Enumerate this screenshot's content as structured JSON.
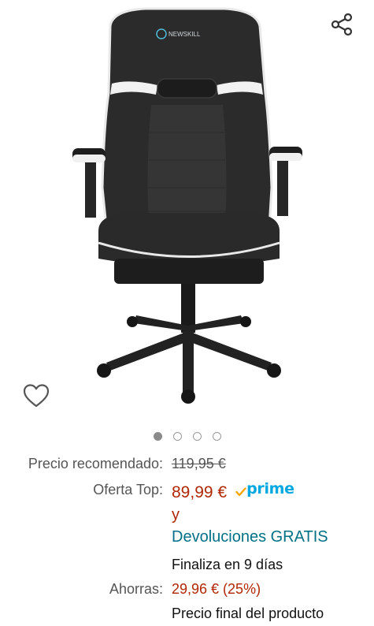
{
  "product": {
    "image_alt": "Silla gaming Newskill negra con ribetes blancos",
    "brand_on_chair": "NEWSKILL",
    "carousel": {
      "count": 4,
      "active_index": 0
    }
  },
  "pricing": {
    "recommended_label": "Precio recomendado:",
    "recommended_value": "119,95 €",
    "deal_label": "Oferta Top:",
    "deal_value": "89,99 €",
    "prime_label": "prime",
    "and_text": "y",
    "returns_text": "Devoluciones GRATIS",
    "ends_text": "Finaliza en 9 días",
    "savings_label": "Ahorras:",
    "savings_value": "29,96 € (25%)",
    "final_text": "Precio final del producto"
  },
  "icons": {
    "share": "share-icon",
    "wishlist": "heart-icon",
    "prime_check": "prime-check-icon"
  },
  "colors": {
    "price": "#b12704",
    "link": "#007185",
    "prime": "#00a8e1"
  }
}
